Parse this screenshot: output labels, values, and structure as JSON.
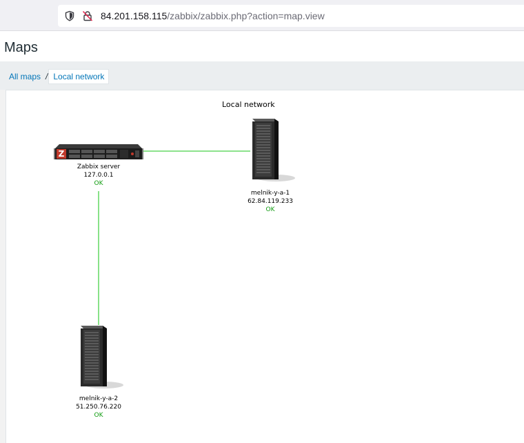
{
  "browser": {
    "url_host": "84.201.158.115",
    "url_path": "/zabbix/zabbix.php?action=map.view",
    "icons": [
      "shield-icon",
      "lock-icon"
    ]
  },
  "page": {
    "title": "Maps"
  },
  "breadcrumb": {
    "root": "All maps",
    "separator": "/",
    "current": "Local network"
  },
  "map": {
    "title": "Local network",
    "hosts": [
      {
        "name": "Zabbix server",
        "ip": "127.0.0.1",
        "status": "OK",
        "icon": "rack-server-icon"
      },
      {
        "name": "melnik-y-a-1",
        "ip": "62.84.119.233",
        "status": "OK",
        "icon": "tower-server-icon"
      },
      {
        "name": "melnik-y-a-2",
        "ip": "51.250.76.220",
        "status": "OK",
        "icon": "tower-server-icon"
      }
    ],
    "link_color": "#48d148",
    "status_ok_color": "#0f9b0f"
  }
}
